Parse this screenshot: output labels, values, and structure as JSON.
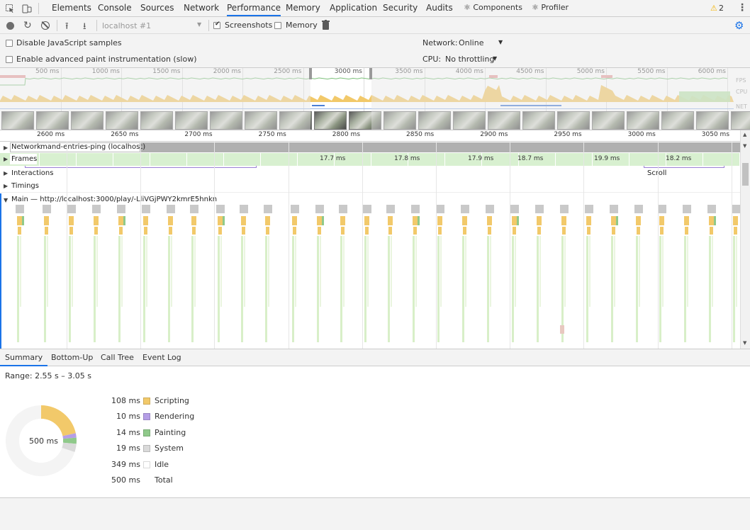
{
  "tabs": [
    {
      "label": "Elements"
    },
    {
      "label": "Console"
    },
    {
      "label": "Sources"
    },
    {
      "label": "Network"
    },
    {
      "label": "Performance"
    },
    {
      "label": "Memory"
    },
    {
      "label": "Application"
    },
    {
      "label": "Security"
    },
    {
      "label": "Audits"
    },
    {
      "label": "⚛ Components"
    },
    {
      "label": "⚛ Profiler"
    }
  ],
  "warnings": {
    "count": "2"
  },
  "toolbar": {
    "target": "localhost #1",
    "screenshots_label": "Screenshots",
    "screenshots_checked": true,
    "memory_label": "Memory",
    "memory_checked": false
  },
  "settings": {
    "disable_js_samples": "Disable JavaScript samples",
    "advanced_paint": "Enable advanced paint instrumentation (slow)",
    "network_label": "Network:",
    "network_value": "Online",
    "cpu_label": "CPU:",
    "cpu_value": "No throttling"
  },
  "overview": {
    "ticks": [
      "500 ms",
      "1000 ms",
      "1500 ms",
      "2000 ms",
      "2500 ms",
      "3000 ms",
      "3500 ms",
      "4000 ms",
      "4500 ms",
      "5000 ms",
      "5500 ms",
      "6000 ms"
    ],
    "labels": {
      "fps": "FPS",
      "cpu": "CPU",
      "net": "NET"
    }
  },
  "ruler": {
    "ticks": [
      "2600 ms",
      "2650 ms",
      "2700 ms",
      "2750 ms",
      "2800 ms",
      "2850 ms",
      "2900 ms",
      "2950 ms",
      "3000 ms",
      "3050 ms"
    ]
  },
  "tracks": {
    "network": "Network",
    "network_request": "mand-entries-ping (localhost)",
    "frames": "Frames",
    "frame_times": [
      "17.7 ms",
      "17.8 ms",
      "17.9 ms",
      "18.7 ms",
      "19.9 ms",
      "18.2 ms"
    ],
    "interactions": "Interactions",
    "interaction_label": "Scroll",
    "timings": "Timings",
    "main": "Main — http://localhost:3000/play/-LliVGjPWY2kmrE5hnkn"
  },
  "detail_tabs": [
    {
      "label": "Summary"
    },
    {
      "label": "Bottom-Up"
    },
    {
      "label": "Call Tree"
    },
    {
      "label": "Event Log"
    }
  ],
  "summary": {
    "range": "Range: 2.55 s – 3.05 s",
    "total_center": "500 ms",
    "rows": [
      {
        "value": "108 ms",
        "name": "Scripting",
        "ms": 108,
        "color": "#f2c96a"
      },
      {
        "value": "10 ms",
        "name": "Rendering",
        "ms": 10,
        "color": "#b59ee6"
      },
      {
        "value": "14 ms",
        "name": "Painting",
        "ms": 14,
        "color": "#8fc98a"
      },
      {
        "value": "19 ms",
        "name": "System",
        "ms": 19,
        "color": "#dadada"
      },
      {
        "value": "349 ms",
        "name": "Idle",
        "ms": 349,
        "color": "#ffffff"
      },
      {
        "value": "500 ms",
        "name": "Total",
        "ms": 500,
        "color": "none"
      }
    ]
  },
  "colors": {
    "accent": "#1a73e8",
    "scripting": "#f2c96a",
    "rendering": "#b59ee6",
    "painting": "#8fc98a",
    "system": "#dadada",
    "frames": "#d8f0d0",
    "warning": "#f4b400"
  }
}
